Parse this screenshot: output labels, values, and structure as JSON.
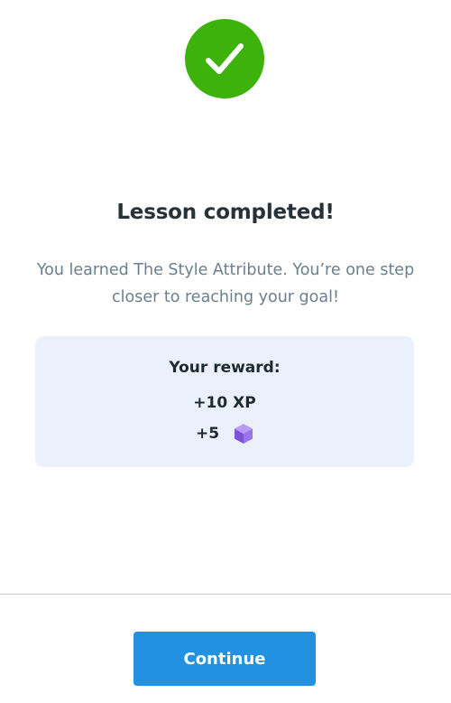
{
  "status": {
    "icon": "checkmark-icon",
    "color": "#3cb20b"
  },
  "lesson": {
    "title": "Lesson completed!",
    "message": "You learned The Style Attribute. You’re one step closer to reaching your goal!"
  },
  "reward": {
    "title": "Your reward:",
    "xp": "+10 XP",
    "gems": "+5",
    "gem_icon": "purple-gem-icon",
    "card_color": "#ebf1fb"
  },
  "actions": {
    "continue_label": "Continue",
    "button_color": "#2291e0"
  }
}
